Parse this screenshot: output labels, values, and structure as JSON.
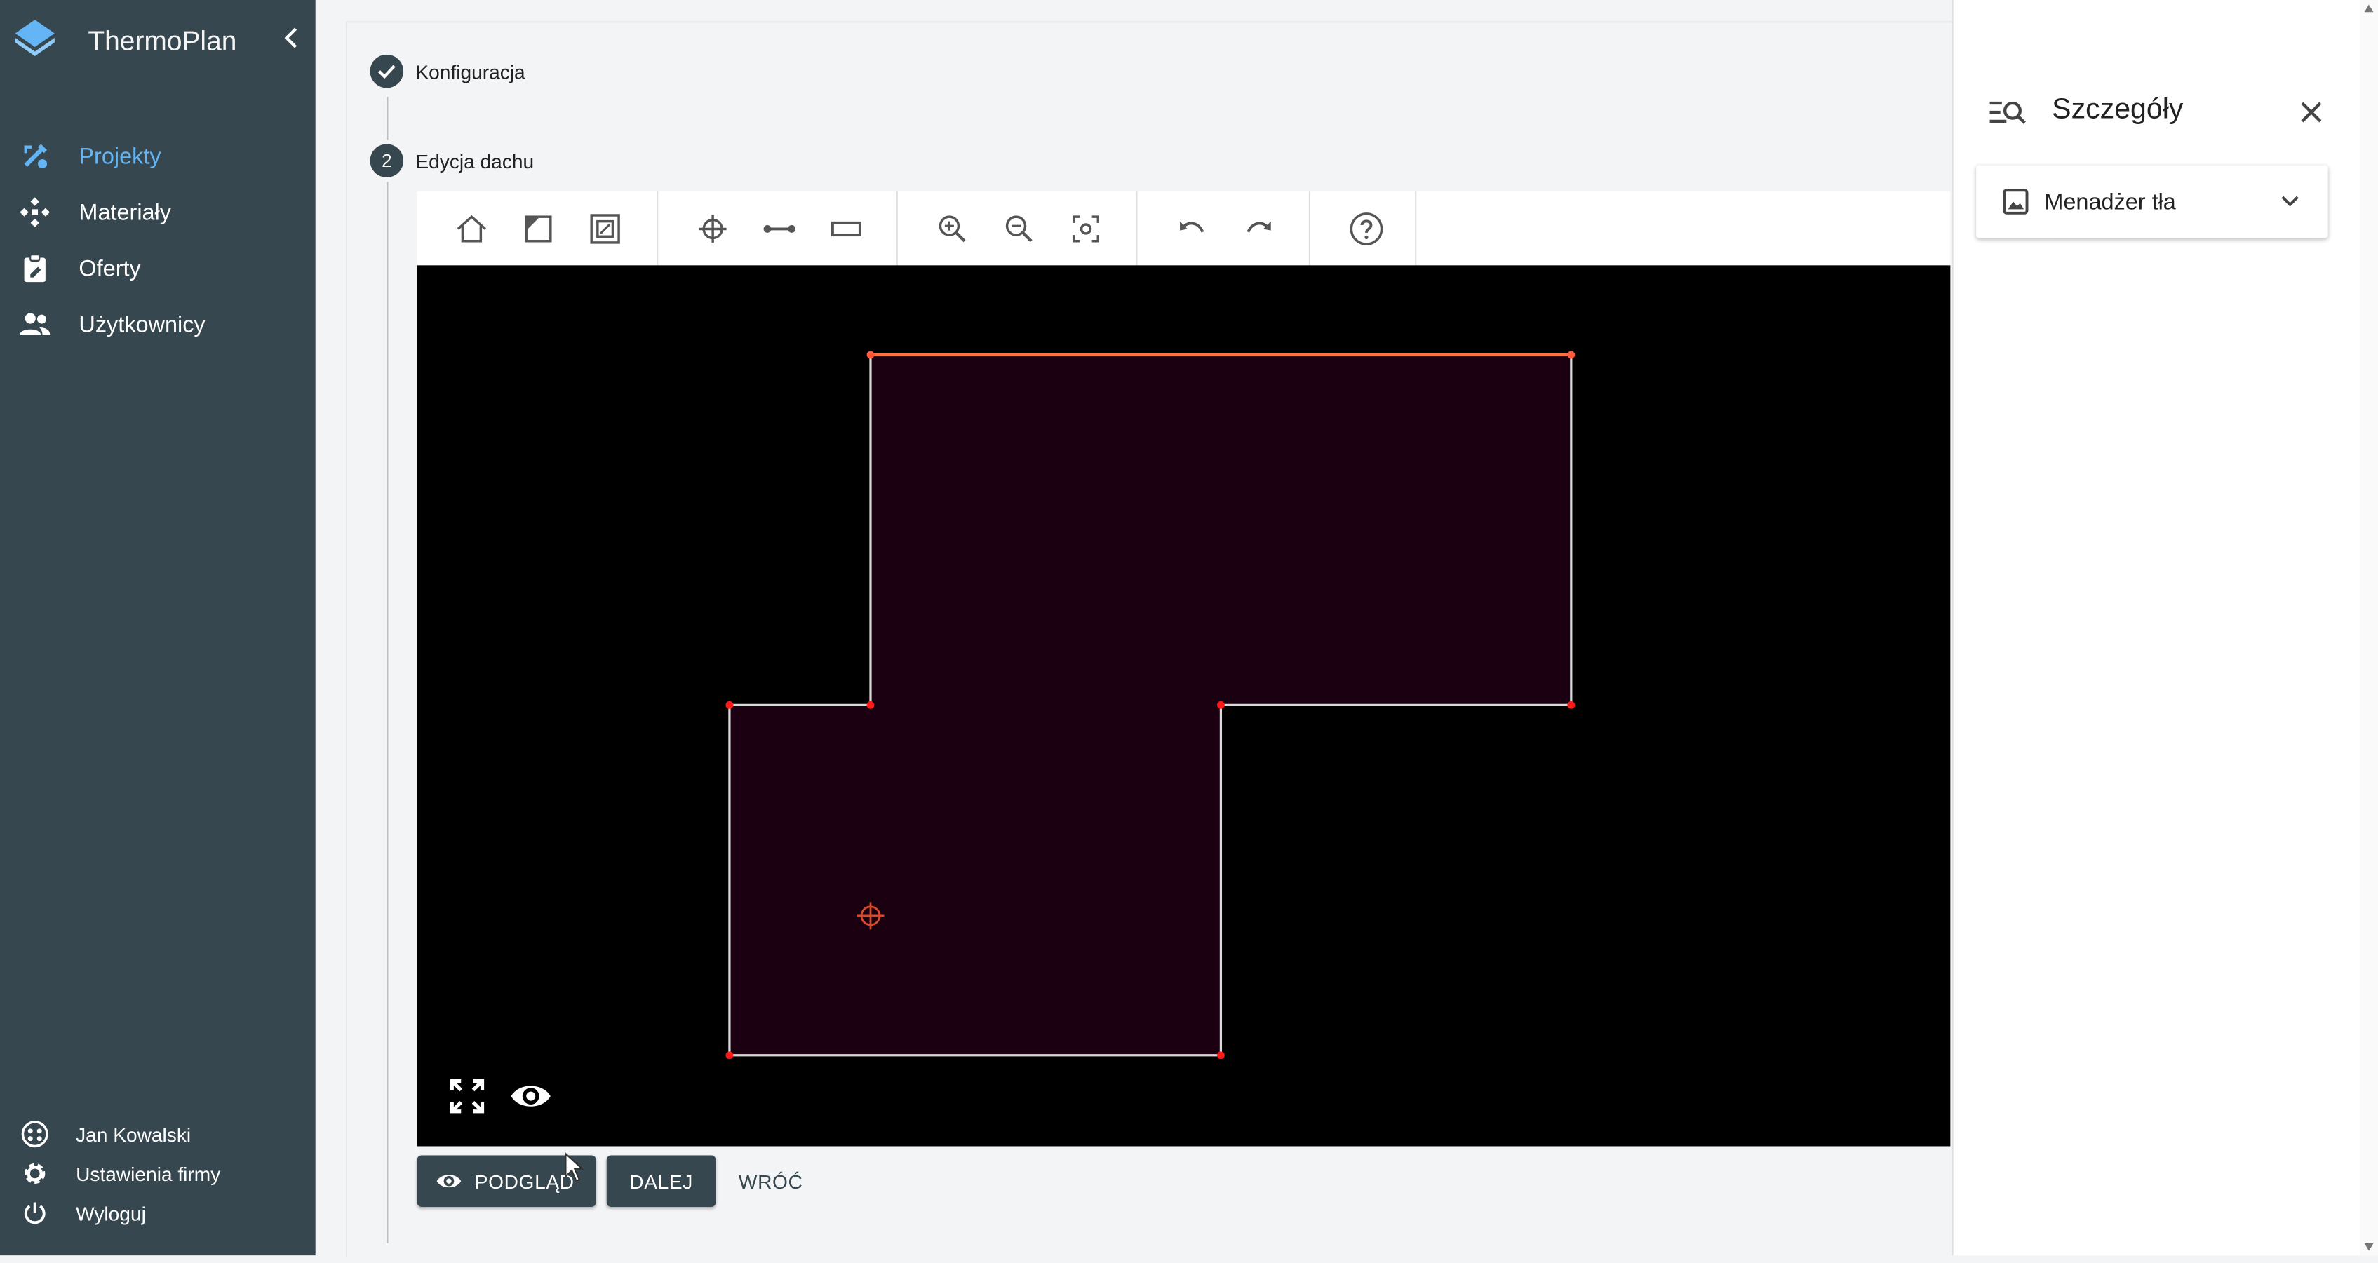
{
  "app": {
    "title": "ThermoPlan"
  },
  "nav": {
    "items": [
      {
        "label": "Projekty",
        "icon": "projects-icon",
        "active": true
      },
      {
        "label": "Materiały",
        "icon": "materials-icon",
        "active": false
      },
      {
        "label": "Oferty",
        "icon": "offers-icon",
        "active": false
      },
      {
        "label": "Użytkownicy",
        "icon": "users-icon",
        "active": false
      }
    ],
    "footer": [
      {
        "label": "Jan Kowalski",
        "icon": "user-avatar-icon"
      },
      {
        "label": "Ustawienia firmy",
        "icon": "gear-icon"
      },
      {
        "label": "Wyloguj",
        "icon": "power-icon"
      }
    ]
  },
  "stepper": {
    "steps": [
      {
        "label": "Konfiguracja",
        "status": "done"
      },
      {
        "number": "2",
        "label": "Edycja dachu",
        "status": "active"
      }
    ]
  },
  "toolbar": {
    "groups": [
      [
        "home-icon",
        "roof-surface-icon",
        "opening-icon"
      ],
      [
        "crosshair-icon",
        "line-segment-icon",
        "rectangle-icon"
      ],
      [
        "zoom-in-icon",
        "zoom-out-icon",
        "fit-view-icon"
      ],
      [
        "undo-icon",
        "redo-icon"
      ],
      [
        "help-icon"
      ]
    ]
  },
  "actions": {
    "preview": "PODGLĄD",
    "next": "DALEJ",
    "back": "WRÓĆ"
  },
  "panel": {
    "title": "Szczegóły",
    "accordion": {
      "label": "Menadżer tła"
    }
  },
  "colors": {
    "sidebar": "#37474f",
    "accent": "#64b5f6",
    "canvas": "#000000",
    "roof_fill": "#1a0010",
    "roof_edge": "#d9d9d9",
    "roof_edge_selected": "#ff7043",
    "vertex": "#ff1a1a"
  }
}
